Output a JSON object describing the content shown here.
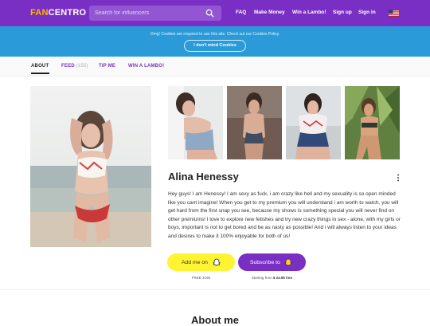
{
  "brand": {
    "logo_fan": "FAN",
    "logo_centro": "CENTRO"
  },
  "search": {
    "placeholder": "Search for influencers",
    "icon": "search-icon"
  },
  "nav": {
    "faq": "FAQ",
    "make_money": "Make Money",
    "win_lambo": "Win a Lambo!",
    "signup": "Sign up",
    "signin": "Sign in",
    "flag_icon": "us-flag-icon"
  },
  "cookie": {
    "text": "Omg! Cookies are required to use this site. Check out our Cookies Policy.",
    "button": "I don't mind Cookies"
  },
  "tabs": {
    "about": "ABOUT",
    "feed": "FEED",
    "feed_count": "(155)",
    "tip": "TIP ME",
    "lambo": "WIN A LAMBO!"
  },
  "profile": {
    "name": "Alina Henessy",
    "bio": "Hey guys! I am Henessy! I am sexy as fuck, i am crazy like hell and my sexuality is so open minded like you cant imagine! When you get to my premium you will understand i am worth to watch, you will get hard from the first snap you see, because my shows is something special you will never find on other premiums! I love to explore new fetishes and try new crazy things in sex - alone, with my girls or boys, important is not to get bored and be as nasty as possible! And i will always listen to your ideas and desires to make it 100% enjoyable for both of us!",
    "add_me": "Add me on",
    "subscribe": "Subscribe to",
    "free_join": "FREE JOIN",
    "starting_from": "Starting from",
    "price": "$ 24.95 /mo"
  },
  "section": {
    "about_heading": "About me"
  },
  "colors": {
    "brand_purple": "#7a2fc4",
    "cookie_blue": "#2a9ad8",
    "snap_yellow": "#fff432",
    "logo_orange": "#ffb400"
  }
}
